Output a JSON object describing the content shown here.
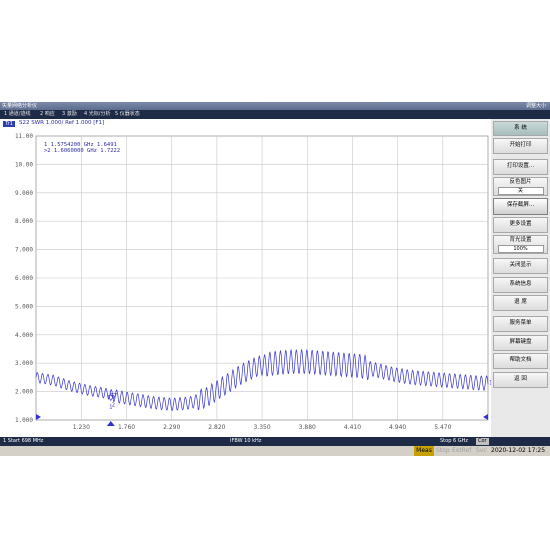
{
  "window": {
    "title": "矢量网络分析仪",
    "resize_label": "调整大小"
  },
  "menu": [
    "1 通道/迹线",
    "2 响应",
    "3 激励",
    "4 光标/分析",
    "5 仪器状态"
  ],
  "trace_info": {
    "badge": "Tr1",
    "text": "S22 SWR 1.000/ Ref 1.000 [F1]"
  },
  "markers": [
    {
      "label": "1",
      "freq": "1.5754200 GHz",
      "value": "1.6491",
      "x_ghz": 1.57542,
      "y": 1.6491
    },
    {
      "label": ">2",
      "freq": "1.6060000 GHz",
      "value": "1.7222",
      "x_ghz": 1.606,
      "y": 1.7222
    }
  ],
  "right_marker_label": "1",
  "softkeys": [
    {
      "label": "系    统",
      "type": "header"
    },
    {
      "label": "开始打印"
    },
    {
      "label": "打印设置..."
    },
    {
      "label": "反色图片",
      "sub": "关"
    },
    {
      "label": "保存截屏...",
      "type": "active"
    },
    {
      "label": "更多设置"
    },
    {
      "label": "背光设置",
      "sub": "100%"
    },
    {
      "label": "关闭显示"
    },
    {
      "label": "系统信息"
    },
    {
      "label": "退    席"
    },
    {
      "label": "服务菜单"
    },
    {
      "label": "屏幕键盘"
    },
    {
      "label": "帮助文档"
    },
    {
      "label": "返    回"
    }
  ],
  "status": {
    "start": "1 Start 698 MHz",
    "ifbw": "IFBW 10 kHz",
    "stop": "Stop 6 GHz",
    "cor": "Cor"
  },
  "bottom": {
    "meas": "Meas",
    "stop": "Stop",
    "extref": "ExtRef",
    "svc": "Svc",
    "datetime": "2020-12-02 17:25"
  },
  "chart_data": {
    "type": "line",
    "x_range_ghz": [
      0.698,
      6.0
    ],
    "ylim": [
      1.0,
      11.0
    ],
    "y_ticks": [
      "11.00",
      "10.00",
      "9.000",
      "8.000",
      "7.000",
      "6.000",
      "5.000",
      "4.000",
      "3.000",
      "2.000",
      "1.000"
    ],
    "x_ticks": [
      "1.230",
      "1.760",
      "2.290",
      "2.820",
      "3.350",
      "3.880",
      "4.410",
      "4.940",
      "5.470"
    ],
    "grid": true,
    "colors": {
      "trace": "#3333cc",
      "grid": "#c8c8c8",
      "axis_text": "#555555"
    },
    "series": [
      {
        "x": [
          0.698,
          0.9,
          1.1,
          1.3,
          1.5,
          1.7,
          1.9,
          2.1,
          2.3,
          2.5,
          2.7,
          2.9,
          3.1,
          3.3,
          3.5,
          3.7,
          3.9,
          4.1,
          4.3,
          4.5,
          4.7,
          4.9,
          5.1,
          5.3,
          5.5,
          5.7,
          5.9,
          6.0
        ],
        "y": [
          2.5,
          2.4,
          2.2,
          2.05,
          1.95,
          1.8,
          1.7,
          1.6,
          1.55,
          1.6,
          1.8,
          2.2,
          2.6,
          2.9,
          3.0,
          3.05,
          3.05,
          3.0,
          2.95,
          2.9,
          2.75,
          2.6,
          2.5,
          2.45,
          2.4,
          2.35,
          2.3,
          2.3
        ]
      }
    ]
  }
}
